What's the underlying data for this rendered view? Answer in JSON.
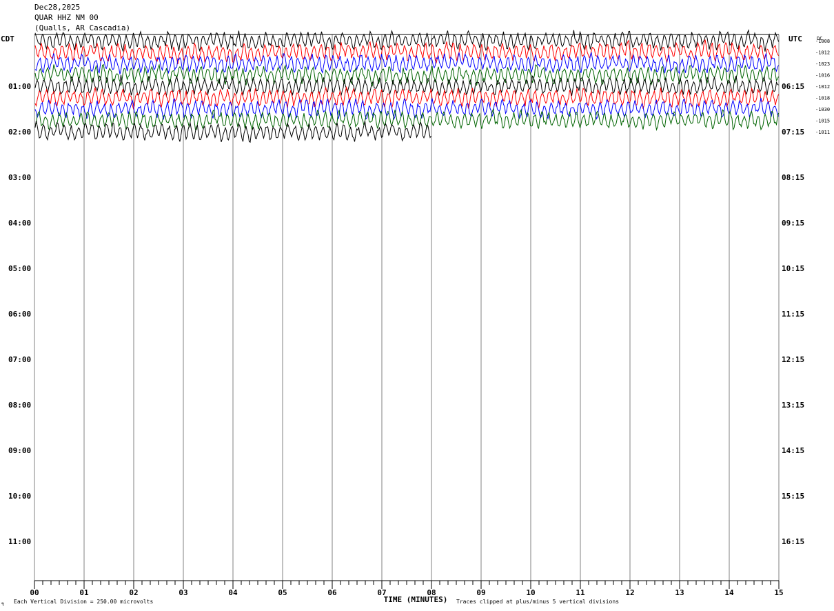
{
  "header": {
    "date": "Dec28,2025",
    "station": "QUAR HHZ NM 00",
    "location": "(Qualls, AR Cascadia)"
  },
  "left_timezone": "CDT",
  "right_timezone": "UTC",
  "dc_header": "DC",
  "footer": {
    "scale_note": "Each Vertical Division =  250.00 microvolts",
    "clip_note": "Traces clipped at plus/minus 5 vertical divisions",
    "x_axis_title": "TIME (MINUTES)"
  },
  "chart_data": {
    "type": "line",
    "title": "QUAR HHZ NM 00",
    "xlabel": "TIME (MINUTES)",
    "x_ticks": [
      "00",
      "01",
      "02",
      "03",
      "04",
      "05",
      "06",
      "07",
      "08",
      "09",
      "10",
      "11",
      "12",
      "13",
      "14",
      "15"
    ],
    "xlim": [
      0,
      15
    ],
    "row_minutes": 15,
    "left_hour_labels": [
      "01:00",
      "02:00",
      "03:00",
      "04:00",
      "05:00",
      "06:00",
      "07:00",
      "08:00",
      "09:00",
      "10:00",
      "11:00"
    ],
    "right_hour_labels": [
      "06:15",
      "07:15",
      "08:15",
      "09:15",
      "10:15",
      "11:15",
      "12:15",
      "13:15",
      "14:15",
      "15:15",
      "16:15"
    ],
    "trace_colors": [
      "#000000",
      "#ff0000",
      "#0000ff",
      "#006400"
    ],
    "rows": [
      {
        "color": "#000000",
        "dc": "-1008",
        "end_minute": 15
      },
      {
        "color": "#ff0000",
        "dc": "-1012",
        "end_minute": 15
      },
      {
        "color": "#0000ff",
        "dc": "-1023",
        "end_minute": 15
      },
      {
        "color": "#006400",
        "dc": "-1016",
        "end_minute": 15
      },
      {
        "color": "#000000",
        "dc": "-1012",
        "end_minute": 15
      },
      {
        "color": "#ff0000",
        "dc": "-1018",
        "end_minute": 15
      },
      {
        "color": "#0000ff",
        "dc": "-1030",
        "end_minute": 15
      },
      {
        "color": "#006400",
        "dc": "-1015",
        "end_minute": 15
      },
      {
        "color": "#000000",
        "dc": "-1011",
        "end_minute": 8
      }
    ]
  }
}
